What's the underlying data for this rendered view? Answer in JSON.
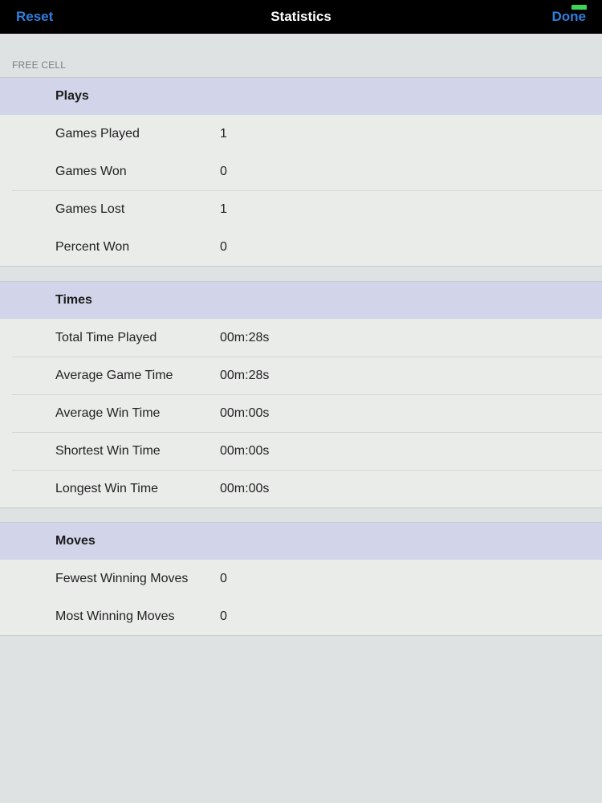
{
  "nav": {
    "left_label": "Reset",
    "title": "Statistics",
    "right_label": "Done",
    "accent_color": "#2f7fe0"
  },
  "section_caption": "FREE CELL",
  "groups": {
    "plays": {
      "title": "Plays",
      "rows": [
        {
          "label": "Games Played",
          "value": "1"
        },
        {
          "label": "Games Won",
          "value": "0"
        },
        {
          "label": "Games Lost",
          "value": "1"
        },
        {
          "label": "Percent Won",
          "value": "0"
        }
      ]
    },
    "times": {
      "title": "Times",
      "rows": [
        {
          "label": "Total Time Played",
          "value": "00m:28s"
        },
        {
          "label": "Average Game Time",
          "value": "00m:28s"
        },
        {
          "label": "Average Win Time",
          "value": "00m:00s"
        },
        {
          "label": "Shortest Win Time",
          "value": "00m:00s"
        },
        {
          "label": "Longest Win Time",
          "value": "00m:00s"
        }
      ]
    },
    "moves": {
      "title": "Moves",
      "rows": [
        {
          "label": "Fewest Winning Moves",
          "value": "0"
        },
        {
          "label": "Most Winning Moves",
          "value": "0"
        }
      ]
    }
  }
}
